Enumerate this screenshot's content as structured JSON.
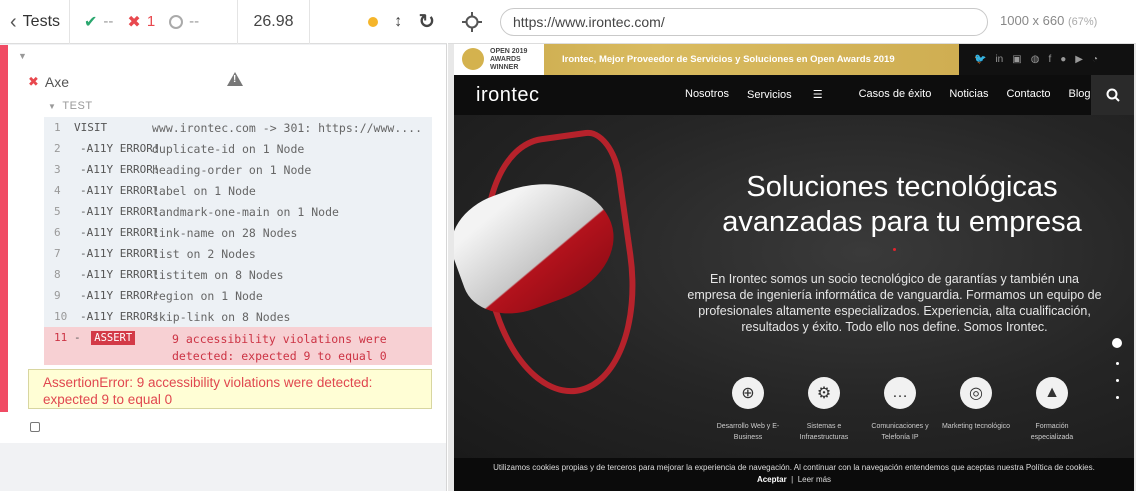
{
  "runner": {
    "tests_label": "Tests",
    "stats": {
      "passed": "--",
      "failed": "1",
      "pending": "--"
    },
    "duration": "26.98",
    "suite": "Axe",
    "test_label": "TEST",
    "commands": [
      {
        "n": "1",
        "name": "VISIT",
        "msg": "www.irontec.com -> 301: https://www...."
      },
      {
        "n": "2",
        "name": "-A11Y ERROR!",
        "msg": "duplicate-id on 1 Node"
      },
      {
        "n": "3",
        "name": "-A11Y ERROR!",
        "msg": "heading-order on 1 Node"
      },
      {
        "n": "4",
        "name": "-A11Y ERROR!",
        "msg": "label on 1 Node"
      },
      {
        "n": "5",
        "name": "-A11Y ERROR!",
        "msg": "landmark-one-main on 1 Node"
      },
      {
        "n": "6",
        "name": "-A11Y ERROR!",
        "msg": "link-name on 28 Nodes"
      },
      {
        "n": "7",
        "name": "-A11Y ERROR!",
        "msg": "list on 2 Nodes"
      },
      {
        "n": "8",
        "name": "-A11Y ERROR!",
        "msg": "listitem on 8 Nodes"
      },
      {
        "n": "9",
        "name": "-A11Y ERROR!",
        "msg": "region on 1 Node"
      },
      {
        "n": "10",
        "name": "-A11Y ERROR!",
        "msg": "skip-link on 8 Nodes"
      }
    ],
    "assert": {
      "n": "11",
      "name": "ASSERT",
      "msg": "9 accessibility violations were detected: expected 9 to equal 0"
    },
    "error": "AssertionError: 9 accessibility violations were detected: expected 9 to equal 0"
  },
  "aut": {
    "url": "https://www.irontec.com/",
    "viewport": "1000 x 660",
    "zoom": "(67%)"
  },
  "site": {
    "award_logo": [
      "OPEN 2019",
      "AWARDS",
      "WINNER"
    ],
    "award_text": "Irontec, Mejor Proveedor de Servicios y Soluciones en Open Awards 2019",
    "social_icons": [
      "twitter-icon",
      "linkedin-icon",
      "youtube-icon",
      "github-icon",
      "facebook-icon",
      "github-alt-icon",
      "youtube-alt-icon",
      "rss-icon"
    ],
    "logo": "irontec",
    "nav": [
      "Nosotros",
      "Servicios",
      "Casos de éxito",
      "Noticias",
      "Contacto",
      "Blog"
    ],
    "hero_title": "Soluciones tecnológicas avanzadas para tu empresa",
    "hero_text": "En Irontec somos un socio tecnológico de garantías y también una empresa de ingeniería informática de vanguardia. Formamos un equipo de profesionales altamente especializados. Experiencia, alta cualificación, resultados y éxito. Todo ello nos define. Somos Irontec.",
    "services": [
      {
        "label": "Desarrollo Web y E-Business",
        "icon": "globe-cart-icon"
      },
      {
        "label": "Sistemas e Infraestructuras",
        "icon": "gear-icon"
      },
      {
        "label": "Comunicaciones y Telefonía IP",
        "icon": "chat-icon"
      },
      {
        "label": "Marketing tecnológico",
        "icon": "target-icon"
      },
      {
        "label": "Formación especializada",
        "icon": "graduation-cap-icon"
      }
    ],
    "cookie_text": "Utilizamos cookies propias y de terceros para mejorar la experiencia de navegación. Al continuar con la navegación entendemos que aceptas nuestra Política de cookies.",
    "cookie_accept": "Aceptar",
    "cookie_more": "Leer más"
  }
}
